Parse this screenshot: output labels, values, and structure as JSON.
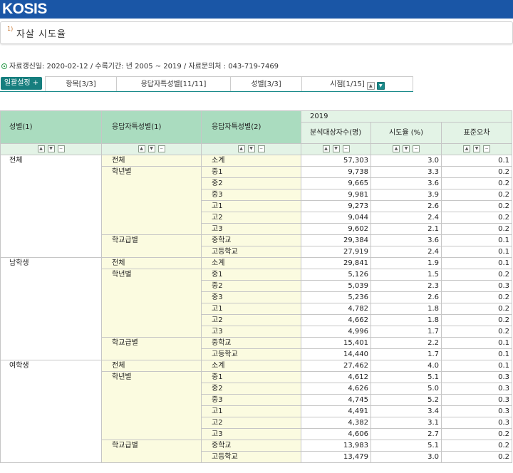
{
  "header": {
    "logo": "KOSIS"
  },
  "title": {
    "superscript": "1)",
    "text": "자살 시도율"
  },
  "info": {
    "text": "자료갱신일: 2020-02-12 / 수록기간: 년 2005 ~ 2019 / 자료문의처 : 043-719-7469"
  },
  "toolbar": {
    "batch_label": "일괄설정 +",
    "tabs": [
      {
        "label": "항목[3/3]"
      },
      {
        "label": "응답자특성별[11/11]"
      },
      {
        "label": "성별[3/3]"
      },
      {
        "label": "시점[1/15]"
      }
    ]
  },
  "table": {
    "headers": [
      "성별(1)",
      "응답자특성별(1)",
      "응답자특성별(2)"
    ],
    "year": "2019",
    "measures": [
      "분석대상자수(명)",
      "시도율 (%)",
      "표준오차"
    ],
    "groups": [
      {
        "gender": "전체",
        "subgroups": [
          {
            "name": "전체",
            "rows": [
              [
                "소계",
                "57,303",
                "3.0",
                "0.1"
              ]
            ]
          },
          {
            "name": "학년별",
            "rows": [
              [
                "중1",
                "9,738",
                "3.3",
                "0.2"
              ],
              [
                "중2",
                "9,665",
                "3.6",
                "0.2"
              ],
              [
                "중3",
                "9,981",
                "3.9",
                "0.2"
              ],
              [
                "고1",
                "9,273",
                "2.6",
                "0.2"
              ],
              [
                "고2",
                "9,044",
                "2.4",
                "0.2"
              ],
              [
                "고3",
                "9,602",
                "2.1",
                "0.2"
              ]
            ]
          },
          {
            "name": "학교급별",
            "rows": [
              [
                "중학교",
                "29,384",
                "3.6",
                "0.1"
              ],
              [
                "고등학교",
                "27,919",
                "2.4",
                "0.1"
              ]
            ]
          }
        ]
      },
      {
        "gender": "남학생",
        "subgroups": [
          {
            "name": "전체",
            "rows": [
              [
                "소계",
                "29,841",
                "1.9",
                "0.1"
              ]
            ]
          },
          {
            "name": "학년별",
            "rows": [
              [
                "중1",
                "5,126",
                "1.5",
                "0.2"
              ],
              [
                "중2",
                "5,039",
                "2.3",
                "0.3"
              ],
              [
                "중3",
                "5,236",
                "2.6",
                "0.2"
              ],
              [
                "고1",
                "4,782",
                "1.8",
                "0.2"
              ],
              [
                "고2",
                "4,662",
                "1.8",
                "0.2"
              ],
              [
                "고3",
                "4,996",
                "1.7",
                "0.2"
              ]
            ]
          },
          {
            "name": "학교급별",
            "rows": [
              [
                "중학교",
                "15,401",
                "2.2",
                "0.1"
              ],
              [
                "고등학교",
                "14,440",
                "1.7",
                "0.1"
              ]
            ]
          }
        ]
      },
      {
        "gender": "여학생",
        "subgroups": [
          {
            "name": "전체",
            "rows": [
              [
                "소계",
                "27,462",
                "4.0",
                "0.1"
              ]
            ]
          },
          {
            "name": "학년별",
            "rows": [
              [
                "중1",
                "4,612",
                "5.1",
                "0.3"
              ],
              [
                "중2",
                "4,626",
                "5.0",
                "0.3"
              ],
              [
                "중3",
                "4,745",
                "5.2",
                "0.3"
              ],
              [
                "고1",
                "4,491",
                "3.4",
                "0.3"
              ],
              [
                "고2",
                "4,382",
                "3.1",
                "0.3"
              ],
              [
                "고3",
                "4,606",
                "2.7",
                "0.2"
              ]
            ]
          },
          {
            "name": "학교급별",
            "rows": [
              [
                "중학교",
                "13,983",
                "5.1",
                "0.2"
              ],
              [
                "고등학교",
                "13,479",
                "3.0",
                "0.2"
              ]
            ]
          }
        ]
      }
    ]
  }
}
